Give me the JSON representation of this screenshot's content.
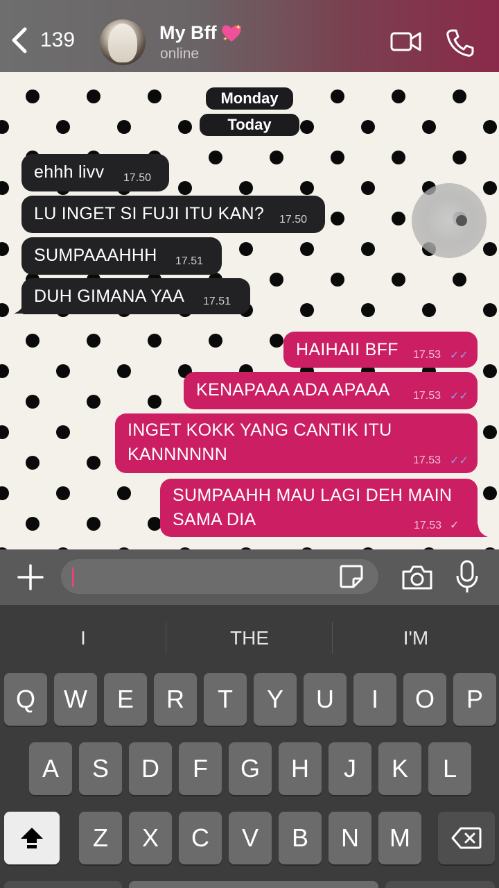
{
  "header": {
    "back_count": "139",
    "contact_name": "My Bff",
    "status": "online"
  },
  "chat": {
    "date_pills": [
      "Monday",
      "Today"
    ],
    "messages": [
      {
        "dir": "in",
        "text": "ehhh livv",
        "time": "17.50"
      },
      {
        "dir": "in",
        "text": "LU INGET SI FUJI ITU KAN?",
        "time": "17.50"
      },
      {
        "dir": "in",
        "text": "SUMPAAAHHH",
        "time": "17.51"
      },
      {
        "dir": "in",
        "text": "DUH GIMANA YAA",
        "time": "17.51"
      },
      {
        "dir": "out",
        "text": "HAIHAII BFF",
        "time": "17.53",
        "ticks": "✓✓"
      },
      {
        "dir": "out",
        "text": "KENAPAAA ADA APAAA",
        "time": "17.53",
        "ticks": "✓✓"
      },
      {
        "dir": "out",
        "lines": [
          "INGET KOKK YANG CANTIK ITU",
          "KANNNNNN"
        ],
        "time": "17.53",
        "ticks": "✓✓"
      },
      {
        "dir": "out",
        "lines": [
          "SUMPAAHH MAU LAGI DEH MAIN",
          "SAMA DIA"
        ],
        "time": "17.53",
        "ticks": "✓"
      }
    ]
  },
  "input": {
    "value": ""
  },
  "keyboard": {
    "suggestions": [
      "I",
      "THE",
      "I'M"
    ],
    "row1": [
      "Q",
      "W",
      "E",
      "R",
      "T",
      "Y",
      "U",
      "I",
      "O",
      "P"
    ],
    "row2": [
      "A",
      "S",
      "D",
      "F",
      "G",
      "H",
      "J",
      "K",
      "L"
    ],
    "row3": [
      "Z",
      "X",
      "C",
      "V",
      "B",
      "N",
      "M"
    ]
  },
  "colors": {
    "outgoing": "#cc1f63",
    "incoming": "#222224",
    "ticks_read": "#8a9cf0"
  }
}
